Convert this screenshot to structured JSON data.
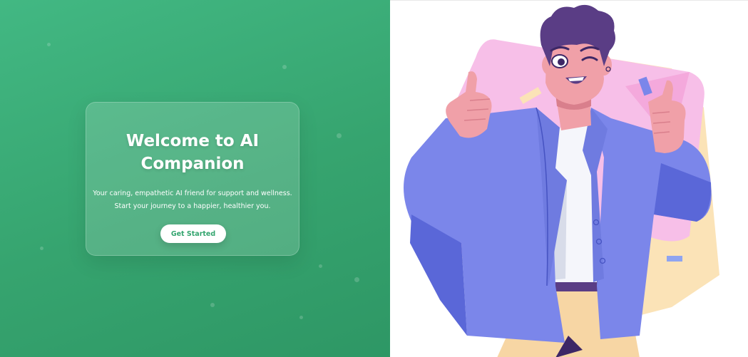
{
  "welcome": {
    "title": "Welcome to AI Companion",
    "description_line1": "Your caring, empathetic AI friend for support and wellness.",
    "description_line2": "Start your journey to a happier, healthier you.",
    "cta_label": "Get Started"
  },
  "colors": {
    "brand_green": "#42b883",
    "brand_green_dark": "#2e9765",
    "button_text": "#34a56f",
    "jacket_blue": "#7b86ea",
    "background_pink": "#f7bfe8",
    "background_cream": "#fbe3b7"
  },
  "illustration": {
    "subject": "cheerful-man-thumbs-up-wink"
  }
}
